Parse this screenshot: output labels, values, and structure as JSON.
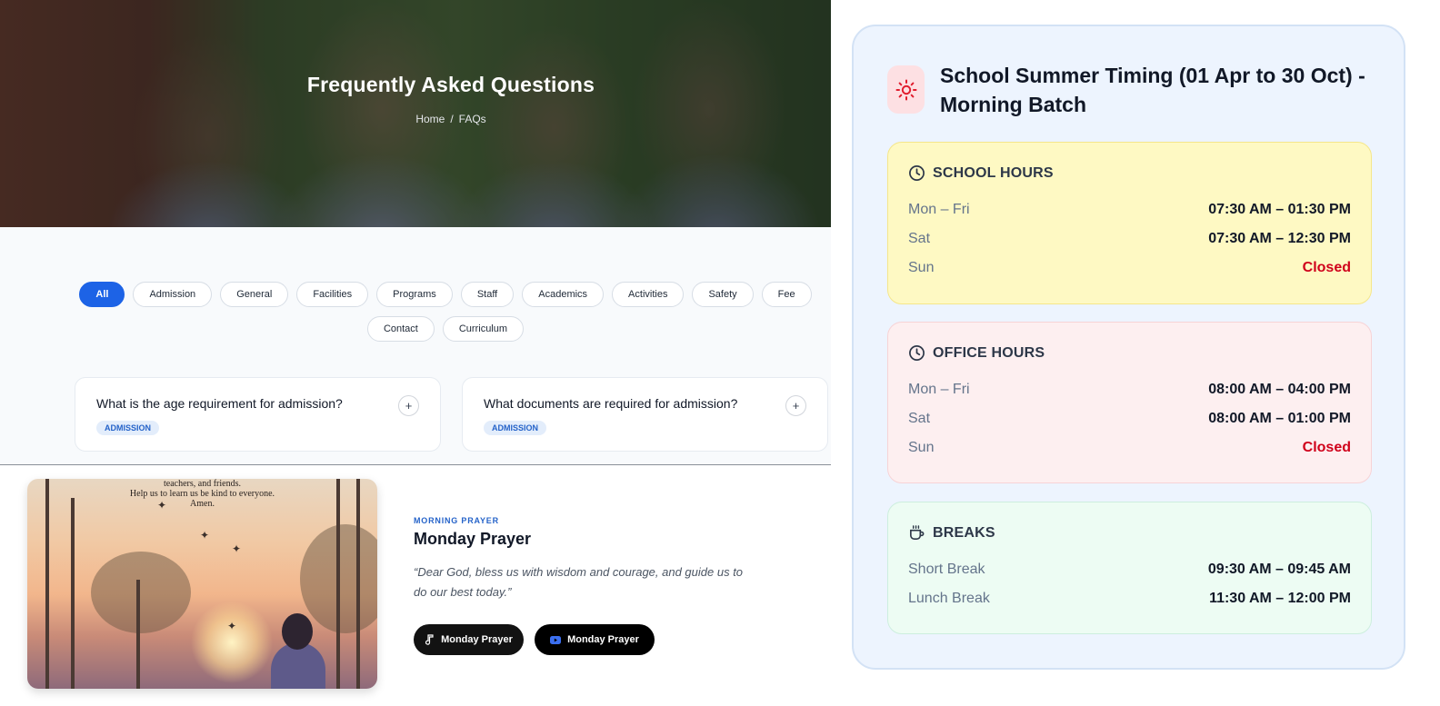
{
  "hero": {
    "title": "Frequently Asked Questions",
    "breadcrumb": {
      "home": "Home",
      "separator": "/",
      "current": "FAQs"
    }
  },
  "filters": [
    "All",
    "Admission",
    "General",
    "Facilities",
    "Programs",
    "Staff",
    "Academics",
    "Activities",
    "Safety",
    "Fee",
    "Contact",
    "Curriculum"
  ],
  "active_filter": "All",
  "faqs": [
    {
      "question": "What is the age requirement for admission?",
      "tag": "ADMISSION",
      "toggle": "+"
    },
    {
      "question": "What documents are required for admission?",
      "tag": "ADMISSION",
      "toggle": "+"
    }
  ],
  "prayer": {
    "image_text": [
      "teachers, and friends.",
      "Help us to learn us be kind to everyone.",
      "Amen."
    ],
    "eyebrow": "MORNING PRAYER",
    "title": "Monday Prayer",
    "quote": "“Dear God, bless us with wisdom and courage, and guide us to do our best today.”",
    "buttons": [
      {
        "label": "Monday Prayer",
        "icon": "music-note-icon"
      },
      {
        "label": "Monday Prayer",
        "icon": "youtube-icon"
      }
    ]
  },
  "timing": {
    "title": "School Summer Timing (01 Apr to 30 Oct) - Morning Batch",
    "icon": "sun-icon",
    "blocks": [
      {
        "heading": "SCHOOL HOURS",
        "icon": "clock-icon",
        "rows": [
          {
            "day": "Mon – Fri",
            "time": "07:30 AM – 01:30 PM"
          },
          {
            "day": "Sat",
            "time": "07:30 AM – 12:30 PM"
          },
          {
            "day": "Sun",
            "time": "Closed"
          }
        ]
      },
      {
        "heading": "OFFICE HOURS",
        "icon": "clock-icon",
        "rows": [
          {
            "day": "Mon – Fri",
            "time": "08:00 AM – 04:00 PM"
          },
          {
            "day": "Sat",
            "time": "08:00 AM – 01:00 PM"
          },
          {
            "day": "Sun",
            "time": "Closed"
          }
        ]
      },
      {
        "heading": "BREAKS",
        "icon": "coffee-cup-icon",
        "rows": [
          {
            "day": "Short Break",
            "time": "09:30 AM – 09:45 AM"
          },
          {
            "day": "Lunch Break",
            "time": "11:30 AM – 12:00 PM"
          }
        ]
      }
    ]
  },
  "colors": {
    "accent": "#1d63e6",
    "closed": "#d0021b",
    "school_hours_bg": "#fef9c3",
    "office_hours_bg": "#fdeff0",
    "breaks_bg": "#edfcf3"
  }
}
